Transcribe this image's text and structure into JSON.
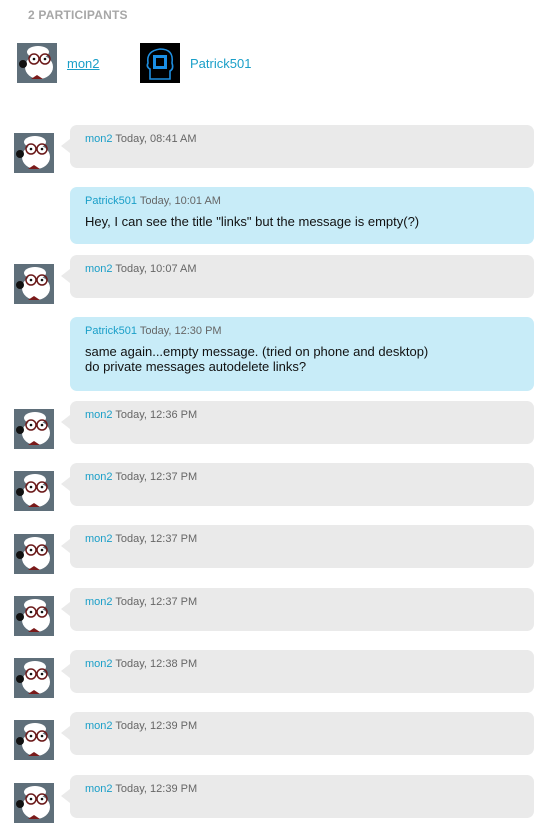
{
  "participants_header": "2 PARTICIPANTS",
  "participants": [
    {
      "name": "mon2",
      "avatar": "dog-avatar"
    },
    {
      "name": "Patrick501",
      "avatar": "head-chip-avatar"
    }
  ],
  "messages": [
    {
      "user": "mon2",
      "time": "Today, 08:41 AM",
      "text": "",
      "style": "grey"
    },
    {
      "user": "Patrick501",
      "time": "Today, 10:01 AM",
      "text": "Hey, I can see the title \"links\" but the message is empty(?)",
      "style": "blue"
    },
    {
      "user": "mon2",
      "time": "Today, 10:07 AM",
      "text": "",
      "style": "grey"
    },
    {
      "user": "Patrick501",
      "time": "Today, 12:30 PM",
      "text": "same again...empty message. (tried on phone and desktop)",
      "text2": "do private messages autodelete links?",
      "style": "blue"
    },
    {
      "user": "mon2",
      "time": "Today, 12:36 PM",
      "text": "",
      "style": "grey"
    },
    {
      "user": "mon2",
      "time": "Today, 12:37 PM",
      "text": "",
      "style": "grey"
    },
    {
      "user": "mon2",
      "time": "Today, 12:37 PM",
      "text": "",
      "style": "grey"
    },
    {
      "user": "mon2",
      "time": "Today, 12:37 PM",
      "text": "",
      "style": "grey"
    },
    {
      "user": "mon2",
      "time": "Today, 12:38 PM",
      "text": "",
      "style": "grey"
    },
    {
      "user": "mon2",
      "time": "Today, 12:39 PM",
      "text": "",
      "style": "grey"
    },
    {
      "user": "mon2",
      "time": "Today, 12:39 PM",
      "text": "",
      "style": "grey"
    }
  ]
}
